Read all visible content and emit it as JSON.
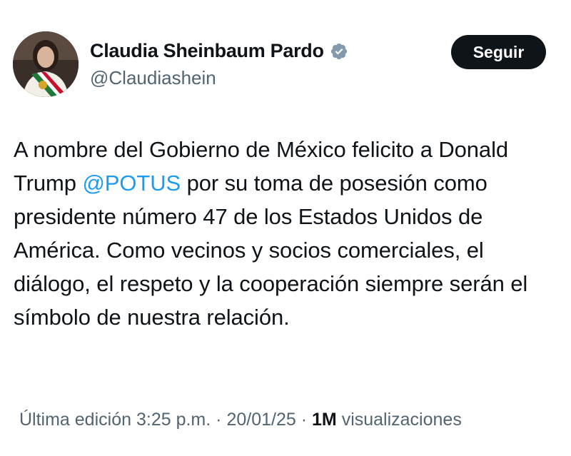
{
  "user": {
    "display_name": "Claudia Sheinbaum Pardo",
    "handle": "@Claudiashein",
    "verified_icon": "verified-badge-icon",
    "follow_label": "Seguir"
  },
  "tweet": {
    "text_before": "A nombre del Gobierno de México felicito a Donald Trump ",
    "mention": "@POTUS",
    "text_after": " por su toma de posesión como presidente número 47 de los Estados Unidos de América. Como vecinos y socios comerciales, el diálogo, el respeto y la cooperación siempre serán el símbolo de nuestra relación."
  },
  "meta": {
    "edited_label": "Última edición",
    "time": "3:25 p.m.",
    "separator": "·",
    "date": "20/01/25",
    "views_count": "1M",
    "views_label": "visualizaciones"
  },
  "colors": {
    "mention": "#1d9bf0",
    "verified": "#829aab",
    "button_bg": "#0f1419",
    "secondary_text": "#536471"
  }
}
